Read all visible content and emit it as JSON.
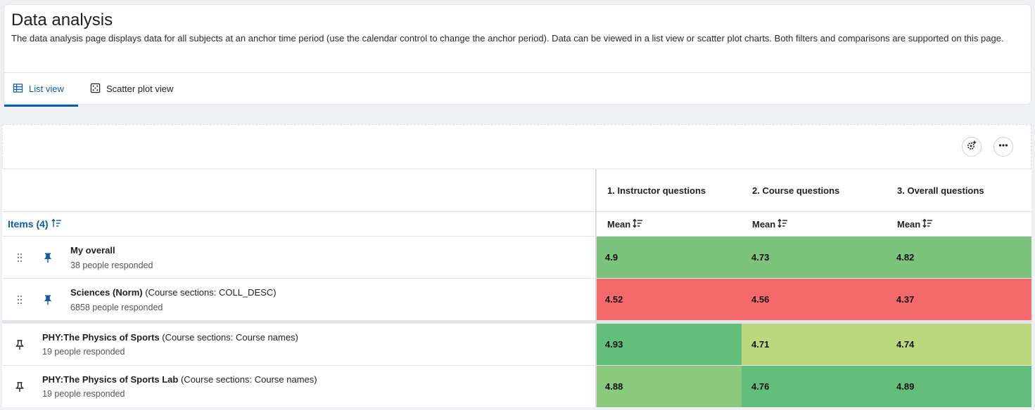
{
  "header": {
    "title": "Data analysis",
    "description": "The data analysis page displays data for all subjects at an anchor time period (use the calendar control to change the anchor period). Data can be viewed in a list view or scatter plot charts. Both filters and comparisons are supported on this page."
  },
  "tabs": [
    {
      "label": "List view",
      "icon": "table-icon",
      "active": true
    },
    {
      "label": "Scatter plot view",
      "icon": "scatter-icon",
      "active": false
    }
  ],
  "toolbar": {
    "settings_icon": "gear-plus-icon",
    "more_icon": "ellipsis-icon"
  },
  "table": {
    "items_header": "Items (4)",
    "columns": [
      {
        "title": "1. Instructor questions",
        "stat": "Mean"
      },
      {
        "title": "2. Course questions",
        "stat": "Mean"
      },
      {
        "title": "3. Overall questions",
        "stat": "Mean"
      }
    ],
    "rows": [
      {
        "name": "My overall",
        "detail": "",
        "responded": "38 people responded",
        "values": [
          "4.9",
          "4.73",
          "4.82"
        ],
        "colors": [
          "#7cc47e",
          "#7cc47e",
          "#7cc47e"
        ]
      },
      {
        "name": "Sciences (Norm)",
        "detail": " (Course sections: COLL_DESC)",
        "responded": "6858 people responded",
        "values": [
          "4.52",
          "4.56",
          "4.37"
        ],
        "colors": [
          "#f4696b",
          "#f4696b",
          "#f4696b"
        ]
      },
      {
        "name": "PHY:The Physics of Sports",
        "detail": " (Course sections: Course names)",
        "responded": "19 people responded",
        "values": [
          "4.93",
          "4.71",
          "4.74"
        ],
        "colors": [
          "#63be7b",
          "#bcd87c",
          "#bcd87c"
        ]
      },
      {
        "name": "PHY:The Physics of Sports Lab",
        "detail": " (Course sections: Course names)",
        "responded": "19 people responded",
        "values": [
          "4.88",
          "4.76",
          "4.89"
        ],
        "colors": [
          "#8bc97d",
          "#63be7b",
          "#63be7b"
        ]
      }
    ]
  },
  "colors": {
    "accent": "#0b5cad",
    "good": "#63be7b",
    "bad": "#f4696b"
  }
}
